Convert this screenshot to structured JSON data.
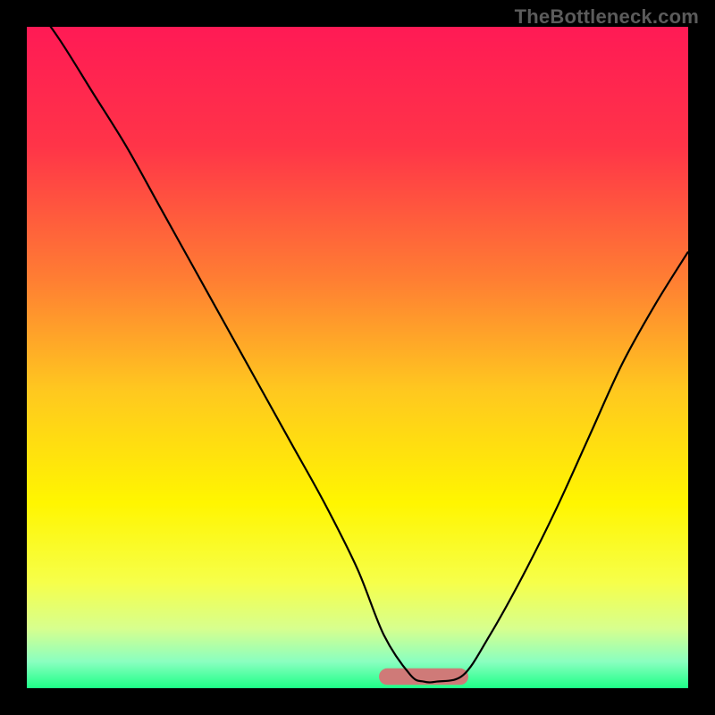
{
  "watermark": "TheBottleneck.com",
  "colors": {
    "frame": "#000000",
    "gradient_stops": [
      {
        "offset": 0.0,
        "color": "#ff1a55"
      },
      {
        "offset": 0.18,
        "color": "#ff3448"
      },
      {
        "offset": 0.38,
        "color": "#ff7d33"
      },
      {
        "offset": 0.55,
        "color": "#ffc81f"
      },
      {
        "offset": 0.72,
        "color": "#fff600"
      },
      {
        "offset": 0.84,
        "color": "#f6ff4a"
      },
      {
        "offset": 0.91,
        "color": "#d7ff8e"
      },
      {
        "offset": 0.96,
        "color": "#8affc0"
      },
      {
        "offset": 1.0,
        "color": "#1dff87"
      }
    ],
    "curve": "#000000",
    "trough_band": "#cf7a78"
  },
  "chart_data": {
    "type": "line",
    "title": "",
    "xlabel": "",
    "ylabel": "",
    "xlim": [
      0,
      100
    ],
    "ylim": [
      0,
      100
    ],
    "series": [
      {
        "name": "bottleneck-curve",
        "x": [
          0,
          5,
          10,
          15,
          20,
          25,
          30,
          35,
          40,
          45,
          50,
          54,
          58,
          60,
          62,
          66,
          70,
          75,
          80,
          85,
          90,
          95,
          100
        ],
        "values": [
          105,
          98,
          90,
          82,
          73,
          64,
          55,
          46,
          37,
          28,
          18,
          8,
          2,
          1,
          1,
          2,
          8,
          17,
          27,
          38,
          49,
          58,
          66
        ]
      }
    ],
    "annotations": [
      {
        "name": "trough-band",
        "x_range": [
          54.5,
          65.5
        ],
        "y_range": [
          0.5,
          3.0
        ]
      }
    ]
  }
}
